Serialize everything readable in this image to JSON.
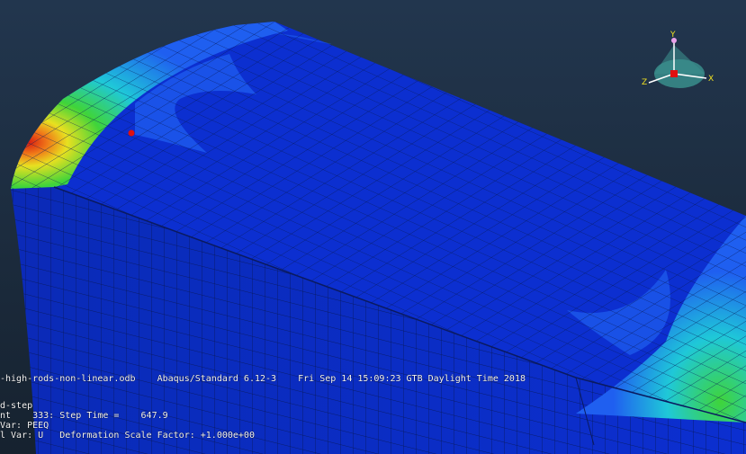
{
  "viewport": {
    "background_top": "#22364e",
    "background_bottom": "#16222f",
    "colors": {
      "mesh_blue": "#0c2fd0",
      "mesh_blue_dark": "#0a24a8",
      "edge": "#0a0a2a",
      "light_blue": "#1f5ff0",
      "cyan": "#1fc8d8",
      "green": "#3fd43a",
      "yellow": "#e8e020",
      "orange": "#f07818",
      "red": "#d81a10"
    }
  },
  "info": {
    "odb_line": "-high-rods-non-linear.odb    Abaqus/Standard 6.12-3    Fri Sep 14 15:09:23 GTB Daylight Time 2018",
    "step_line": "d-step",
    "increment_line": "nt    333: Step Time =    647.9",
    "primary_line": "Var: PEEQ",
    "deform_line": "l Var: U   Deformation Scale Factor: +1.000e+00"
  },
  "triad": {
    "y_label": "Y",
    "x_label": "X",
    "z_label": "Z",
    "colors": {
      "cone": "#3a8e8c",
      "axis": "#ffffff",
      "origin": "#e01010",
      "label": "#f0e020"
    }
  }
}
